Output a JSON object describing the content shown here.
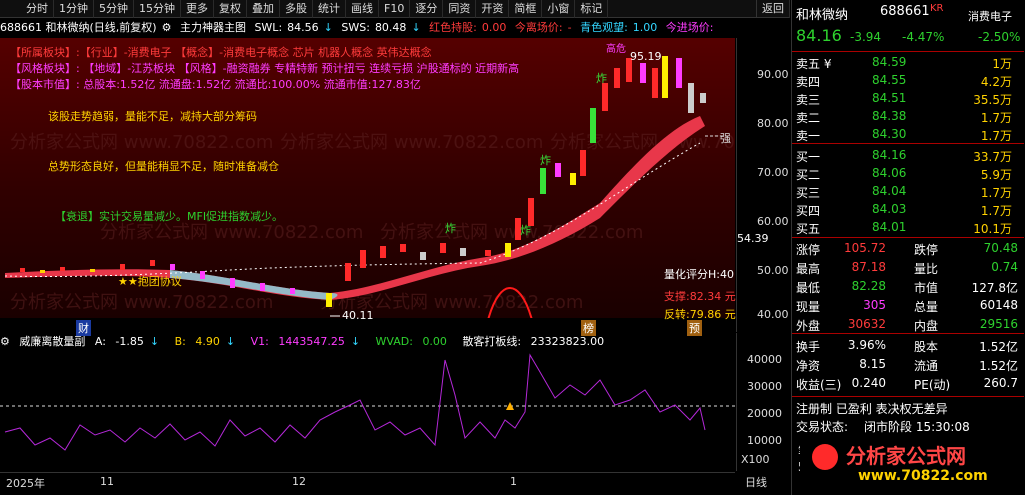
{
  "toolbar": {
    "items": [
      "分时",
      "1分钟",
      "5分钟",
      "15分钟",
      "更多",
      "复权",
      "叠加",
      "多股",
      "统计",
      "画线",
      "F10",
      "逐分",
      "同资",
      "开资",
      "简框",
      "小窗",
      "标记"
    ],
    "back": "返回"
  },
  "titlerow": {
    "stock": "688661 和林微纳(日线,前复权)",
    "indicator": "主力神器主图",
    "swl_label": "SWL:",
    "swl_value": "84.56",
    "sws_label": "SWS:",
    "sws_value": "80.48",
    "hold_label": "红色持股:",
    "hold_value": "0.00",
    "exit_label": "今离场价:",
    "exit_value": "-",
    "watch_label": "青色观望:",
    "watch_value": "1.00",
    "signal_label": "今进场价:"
  },
  "info": {
    "sector_line": "【所属板块】:【行业】-消费电子 【概念】-消费电子概念 芯片 机器人概念 英伟达概念",
    "style_line": "【风格板块】: 【地域】-江苏板块 【风格】-融资融券 专精特新 预计扭亏 连续亏损 沪股通标的 近期新高",
    "capital_line": "【股本市值】: 总股本:1.52亿 流通盘:1.52亿 流通比:100.00% 流通市值:127.83亿",
    "comment1": "该股走势趋弱，量能不足，减持大部分筹码",
    "comment2": "总势形态良好，但量能稍显不足，随时准备减仓",
    "comment3": "【衰退】实计交易量减少。MFI促进指数减少。"
  },
  "chart_labels": {
    "peak": "95.19",
    "peak_tag": "高危",
    "low": "40.11",
    "left_tag": "★★抱团协议",
    "score": "量化评分H:40",
    "support": "支撑:82.34 元",
    "reverse": "反转:79.86 元",
    "strong": "强",
    "price_mark": "54.39",
    "fin_mark": "财",
    "bang_mark": "榜",
    "yu_mark": "预",
    "zha": "炸"
  },
  "main_axis": [
    "90.00",
    "80.00",
    "70.00",
    "60.00",
    "50.00",
    "40.00"
  ],
  "indicator": {
    "name": "威廉离散量副",
    "a_label": "A:",
    "a_value": "-1.85",
    "b_label": "B:",
    "b_value": "4.90",
    "v1_label": "V1:",
    "v1_value": "1443547.25",
    "wvad_label": "WVAD:",
    "wvad_value": "0.00",
    "line_label": "散客打板线:",
    "line_value": "23323823.00",
    "axis": [
      "40000",
      "30000",
      "20000",
      "10000"
    ],
    "unit": "X100"
  },
  "bottom": {
    "year": "2025年",
    "m11": "11",
    "m12": "12",
    "m1": "1",
    "dayline": "日线"
  },
  "quote": {
    "name": "和林微纳",
    "code": "688661",
    "tag": "KR",
    "sector": "消费电子",
    "price": "84.16",
    "change": "-3.94",
    "pct": "-4.47%",
    "sector_pct": "-2.50%",
    "asks": [
      {
        "label": "卖五 ¥",
        "price": "84.59",
        "vol": "1万"
      },
      {
        "label": "卖四",
        "price": "84.55",
        "vol": "4.2万"
      },
      {
        "label": "卖三",
        "price": "84.51",
        "vol": "35.5万"
      },
      {
        "label": "卖二",
        "price": "84.38",
        "vol": "1.7万"
      },
      {
        "label": "卖一",
        "price": "84.30",
        "vol": "1.7万"
      }
    ],
    "bids": [
      {
        "label": "买一",
        "price": "84.16",
        "vol": "33.7万"
      },
      {
        "label": "买二",
        "price": "84.06",
        "vol": "5.9万"
      },
      {
        "label": "买三",
        "price": "84.04",
        "vol": "1.7万"
      },
      {
        "label": "买四",
        "price": "84.03",
        "vol": "1.7万"
      },
      {
        "label": "买五",
        "price": "84.01",
        "vol": "10.1万"
      }
    ],
    "stats": [
      {
        "l1": "涨停",
        "v1": "105.72",
        "l2": "跌停",
        "v2": "70.48"
      },
      {
        "l1": "最高",
        "v1": "87.18",
        "l2": "量比",
        "v2": "0.74"
      },
      {
        "l1": "最低",
        "v1": "82.28",
        "l2": "市值",
        "v2": "127.8亿"
      },
      {
        "l1": "现量",
        "v1": "305",
        "l2": "总量",
        "v2": "60148"
      },
      {
        "l1": "外盘",
        "v1": "30632",
        "l2": "内盘",
        "v2": "29516"
      }
    ],
    "stats2": [
      {
        "l1": "换手",
        "v1": "3.96%",
        "l2": "股本",
        "v2": "1.52亿"
      },
      {
        "l1": "净资",
        "v1": "8.15",
        "l2": "流通",
        "v2": "1.52亿"
      },
      {
        "l1": "收益(三)",
        "v1": "0.240",
        "l2": "PE(动)",
        "v2": "260.7"
      }
    ],
    "reg": "注册制 已盈利 表决权无差异",
    "status_label": "交易状态:",
    "status_value": "闭市阶段 15:30:08",
    "bottom_tabs": [
      "笔",
      "5E"
    ]
  },
  "logo": {
    "text": "分析家公式网",
    "url": "www.70822.com"
  },
  "watermark": "分析家公式网 www.70822.com"
}
